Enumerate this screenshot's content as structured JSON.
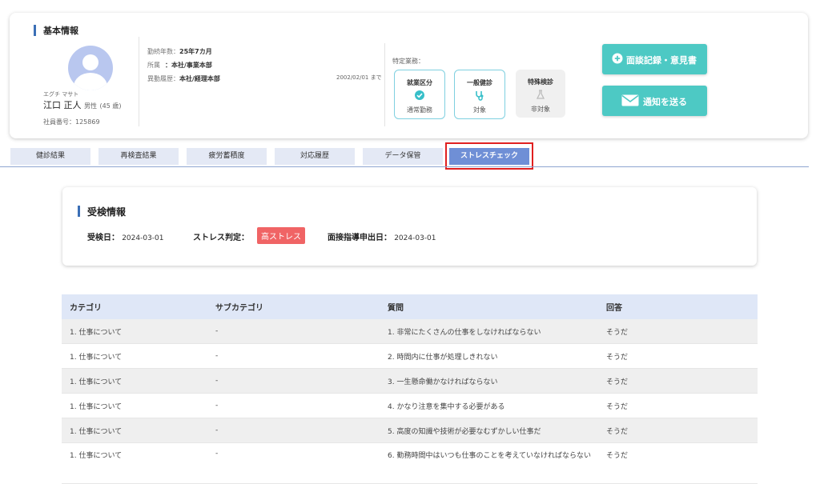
{
  "basic": {
    "title": "基本情報",
    "furigana": "エグチ マサト",
    "name": "江口 正人",
    "gender": "男性",
    "age": "(45 歳)",
    "employee_no": "社員番号：125869",
    "tenure_label": "勤続年数：",
    "tenure_value": "25年7カ月",
    "dept_label": "所属",
    "dept_value": "：本社/事業本部",
    "history_label": "異動履歴：",
    "history_value": "本社/経理本部",
    "history_until": "2002/02/01 まで",
    "special_label": "特定業務："
  },
  "status_boxes": [
    {
      "title": "就業区分",
      "status": "通常勤務",
      "icon": "check-circle-icon",
      "active": true
    },
    {
      "title": "一般健診",
      "status": "対象",
      "icon": "stethoscope-icon",
      "active": true
    },
    {
      "title": "特殊検診",
      "status": "非対象",
      "icon": "flask-icon",
      "active": false
    }
  ],
  "buttons": {
    "interview": "面談記録・意見書",
    "notify": "通知を送る"
  },
  "tabs": [
    "健診結果",
    "再検査結果",
    "疲労蓄積度",
    "対応履歴",
    "データ保管",
    "ストレスチェック"
  ],
  "active_tab": "ストレスチェック",
  "exam": {
    "title": "受検情報",
    "date_label": "受検日：",
    "date_value": "2024-03-01",
    "judgment_label": "ストレス判定：",
    "judgment_value": "高ストレス",
    "request_label": "面接指導申出日：",
    "request_value": "2024-03-01"
  },
  "table": {
    "headers": [
      "カテゴリ",
      "サブカテゴリ",
      "質問",
      "回答"
    ],
    "rows": [
      [
        "1. 仕事について",
        "-",
        "1. 非常にたくさんの仕事をしなければならない",
        "そうだ"
      ],
      [
        "1. 仕事について",
        "-",
        "2. 時間内に仕事が処理しきれない",
        "そうだ"
      ],
      [
        "1. 仕事について",
        "-",
        "3. 一生懸命働かなければならない",
        "そうだ"
      ],
      [
        "1. 仕事について",
        "-",
        "4. かなり注意を集中する必要がある",
        "そうだ"
      ],
      [
        "1. 仕事について",
        "-",
        "5. 高度の知識や技術が必要なむずかしい仕事だ",
        "そうだ"
      ],
      [
        "1. 仕事について",
        "-",
        "6. 勤務時間中はいつも仕事のことを考えていなければならない",
        "そうだ"
      ]
    ]
  },
  "colors": {
    "accent": "#4dc9c4",
    "tab_active": "#6f8fd6",
    "badge": "#f06465",
    "highlight": "#e02020"
  }
}
